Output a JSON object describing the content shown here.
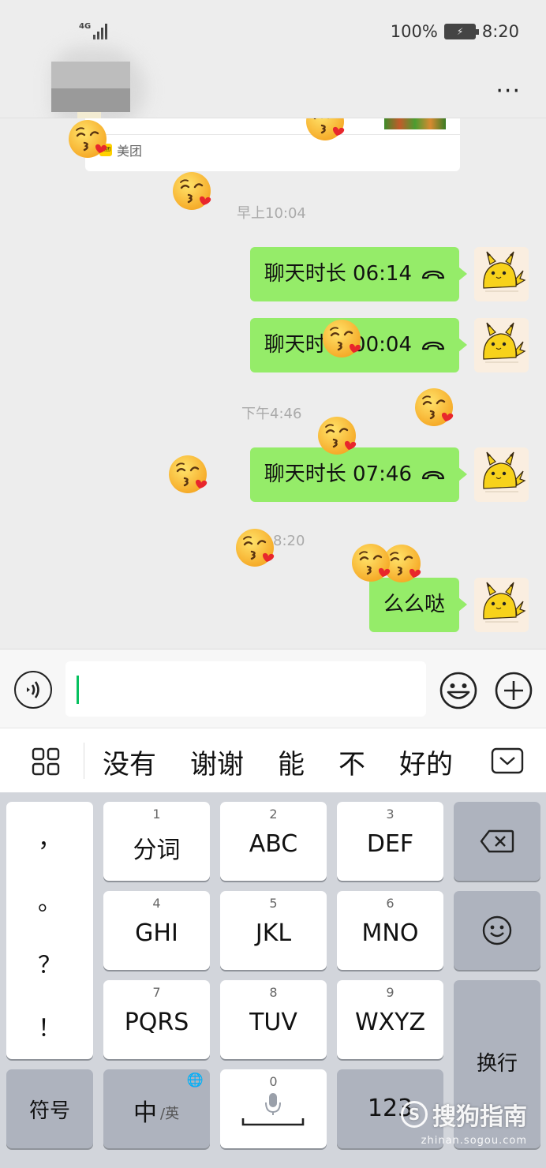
{
  "status_bar": {
    "network": "4G",
    "battery": "100%",
    "time": "8:20"
  },
  "header": {
    "more_label": "···"
  },
  "card": {
    "source": "美团"
  },
  "messages": {
    "time1": "早上10:04",
    "call1": "聊天时长 06:14",
    "call2": "聊天时长 00:04",
    "time2": "下午4:46",
    "call3": "聊天时长 07:46",
    "time3": "8:20",
    "text1": "么么哒"
  },
  "candidates": [
    "没有",
    "谢谢",
    "能",
    "不",
    "好的"
  ],
  "keyboard": {
    "punct": [
      "，",
      "。",
      "？",
      "！"
    ],
    "keys": [
      {
        "num": "1",
        "label": "分词"
      },
      {
        "num": "2",
        "label": "ABC"
      },
      {
        "num": "3",
        "label": "DEF"
      },
      {
        "num": "4",
        "label": "GHI"
      },
      {
        "num": "5",
        "label": "JKL"
      },
      {
        "num": "6",
        "label": "MNO"
      },
      {
        "num": "7",
        "label": "PQRS"
      },
      {
        "num": "8",
        "label": "TUV"
      },
      {
        "num": "9",
        "label": "WXYZ"
      }
    ],
    "symbol": "符号",
    "lang_main": "中",
    "lang_sub": "/英",
    "space_num": "0",
    "num_key": "123",
    "enter": "换行"
  },
  "watermark": {
    "brand": "搜狗指南",
    "url": "zhinan.sogou.com"
  },
  "colors": {
    "bubble": "#95ec69",
    "background": "#ededed",
    "caret": "#07c160",
    "keyboard": "#d2d5db"
  }
}
